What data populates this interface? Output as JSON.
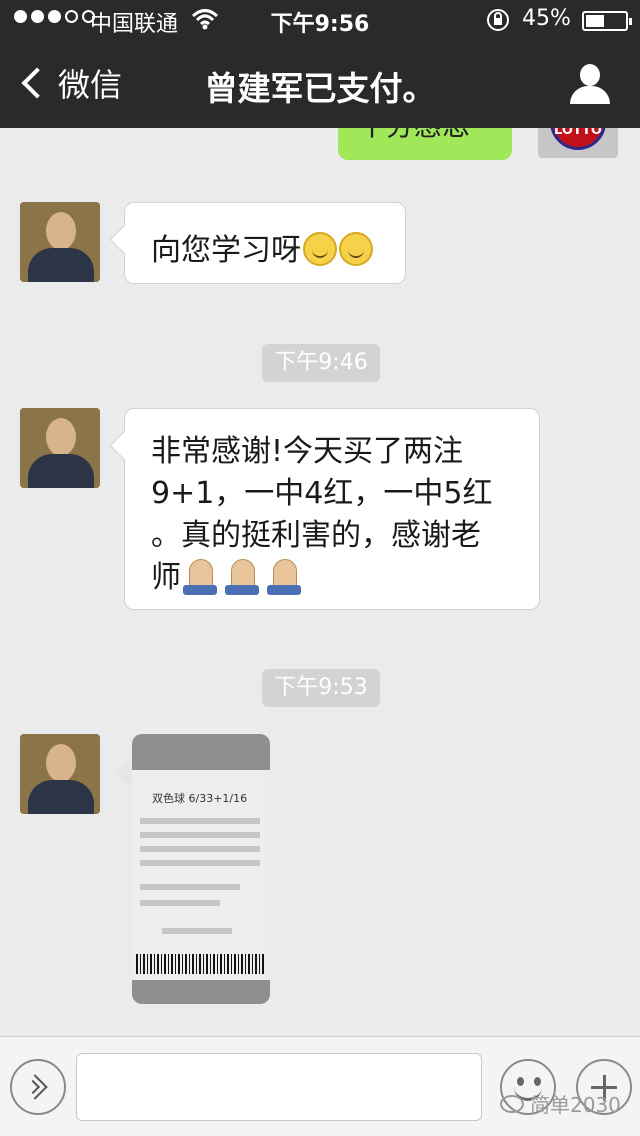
{
  "status_bar": {
    "carrier": "中国联通",
    "time": "下午9:56",
    "battery_percent": "45%",
    "signal_bars_filled": 3,
    "signal_bars_total": 5
  },
  "nav": {
    "back_label": "微信",
    "title": "曾建军已支付。"
  },
  "messages": {
    "sent_partial": "十分感恩",
    "sent_avatar_text": "LOTTO",
    "msg1": "向您学习呀",
    "ts1": "下午9:46",
    "msg2_line1": "非常感谢!今天买了两注",
    "msg2_line2": "9+1，一中4红，一中5红",
    "msg2_line3": "。真的挺利害的，感谢老",
    "msg2_line4": "师",
    "ts2": "下午9:53",
    "ticket_title": "双色球 6/33+1/16"
  },
  "input_bar": {
    "watermark": "简单2030"
  },
  "colors": {
    "nav_bg": "#2a2a2c",
    "sent_bubble": "#a0e75a",
    "chat_bg": "#ebebeb"
  }
}
